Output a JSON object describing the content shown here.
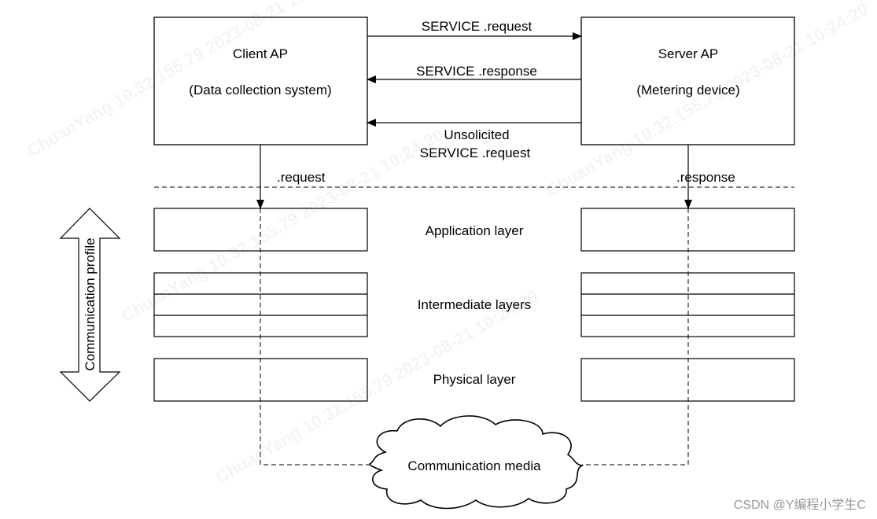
{
  "client": {
    "title": "Client AP",
    "subtitle": "(Data collection system)"
  },
  "server": {
    "title": "Server AP",
    "subtitle": "(Metering device)"
  },
  "messages": {
    "request": "SERVICE .request",
    "response": "SERVICE .response",
    "unsolicited_line1": "Unsolicited",
    "unsolicited_line2": "SERVICE .request"
  },
  "primitives": {
    "client": ".request",
    "server": ".response"
  },
  "layers": {
    "application": "Application layer",
    "intermediate": "Intermediate layers",
    "physical": "Physical layer"
  },
  "profile_label": "Communication profile",
  "media_label": "Communication media",
  "watermark": "ChuanYang 10.32.155.79 2023-08-21 10:24:20",
  "credit": "CSDN @Y编程小学生C"
}
